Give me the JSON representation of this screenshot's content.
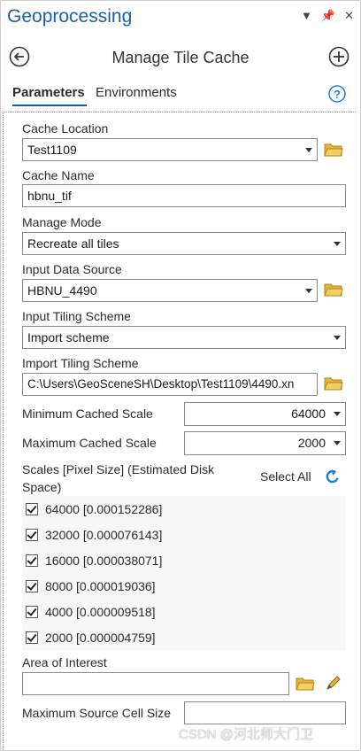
{
  "pane": {
    "title": "Geoprocessing",
    "header": "Manage Tile Cache"
  },
  "tabs": [
    {
      "label": "Parameters",
      "active": true
    },
    {
      "label": "Environments",
      "active": false
    }
  ],
  "params": {
    "cache_location": {
      "label": "Cache Location",
      "value": "Test1109"
    },
    "cache_name": {
      "label": "Cache Name",
      "value": "hbnu_tif"
    },
    "manage_mode": {
      "label": "Manage Mode",
      "value": "Recreate all tiles"
    },
    "input_data_source": {
      "label": "Input Data Source",
      "value": "HBNU_4490"
    },
    "input_tiling_scheme": {
      "label": "Input Tiling Scheme",
      "value": "Import scheme"
    },
    "import_tiling_scheme": {
      "label": "Import Tiling Scheme",
      "value": "C:\\Users\\GeoSceneSH\\Desktop\\Test1109\\4490.xn"
    },
    "min_cached_scale": {
      "label": "Minimum Cached Scale",
      "value": "64000"
    },
    "max_cached_scale": {
      "label": "Maximum Cached Scale",
      "value": "2000"
    },
    "scales": {
      "label": "Scales [Pixel Size] (Estimated Disk Space)",
      "select_all": "Select All",
      "items": [
        {
          "label": "64000 [0.000152286]",
          "checked": true
        },
        {
          "label": "32000 [0.000076143]",
          "checked": true
        },
        {
          "label": "16000 [0.000038071]",
          "checked": true
        },
        {
          "label": "8000 [0.000019036]",
          "checked": true
        },
        {
          "label": "4000 [0.000009518]",
          "checked": true
        },
        {
          "label": "2000 [0.000004759]",
          "checked": true
        }
      ]
    },
    "area_of_interest": {
      "label": "Area of Interest",
      "value": ""
    },
    "max_source_cell_size": {
      "label": "Maximum Source Cell Size",
      "value": ""
    }
  },
  "watermark": "CSDN @河北师大门卫",
  "colors": {
    "accent": "#1c5fa8",
    "folder": "#e3b341"
  }
}
